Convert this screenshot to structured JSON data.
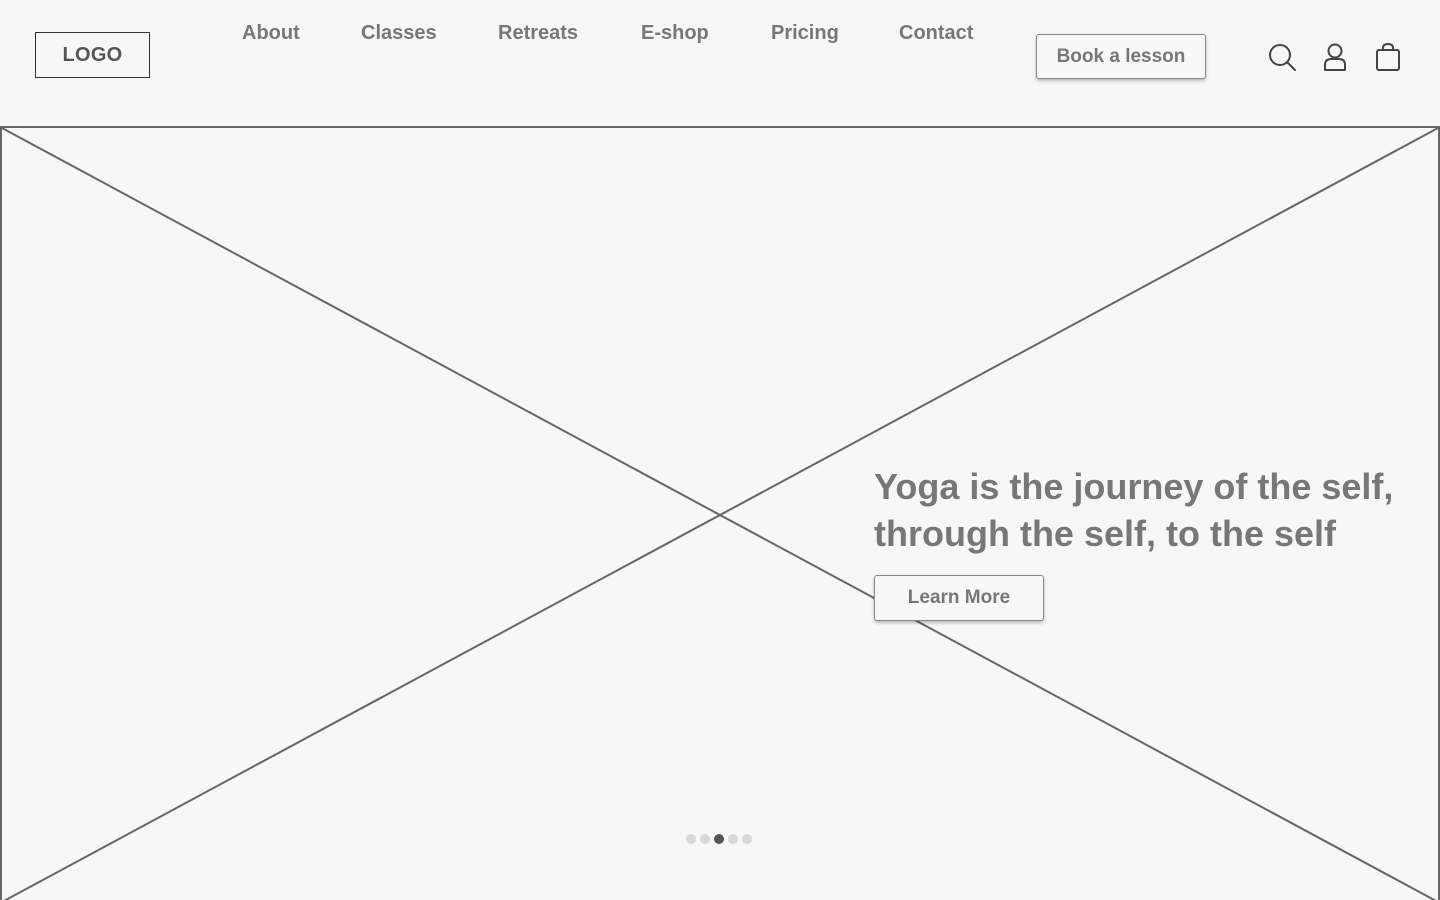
{
  "header": {
    "logo_label": "LOGO",
    "nav": [
      {
        "label": "About"
      },
      {
        "label": "Classes"
      },
      {
        "label": "Retreats"
      },
      {
        "label": "E-shop"
      },
      {
        "label": "Pricing"
      },
      {
        "label": "Contact"
      }
    ],
    "cta_label": "Book a lesson",
    "icons": [
      "search-icon",
      "user-icon",
      "shopping-bag-icon"
    ]
  },
  "hero": {
    "image_placeholder": "image-placeholder",
    "heading_line1": "Yoga is the journey of the self,",
    "heading_line2": "through the self, to the self",
    "cta_label": "Learn More",
    "carousel": {
      "total_slides": 5,
      "active_slide": 3
    }
  },
  "colors": {
    "background": "#f7f7f7",
    "text": "#777777",
    "border": "#666666",
    "dot_active": "#555555",
    "dot_inactive": "#d8d8d8"
  }
}
